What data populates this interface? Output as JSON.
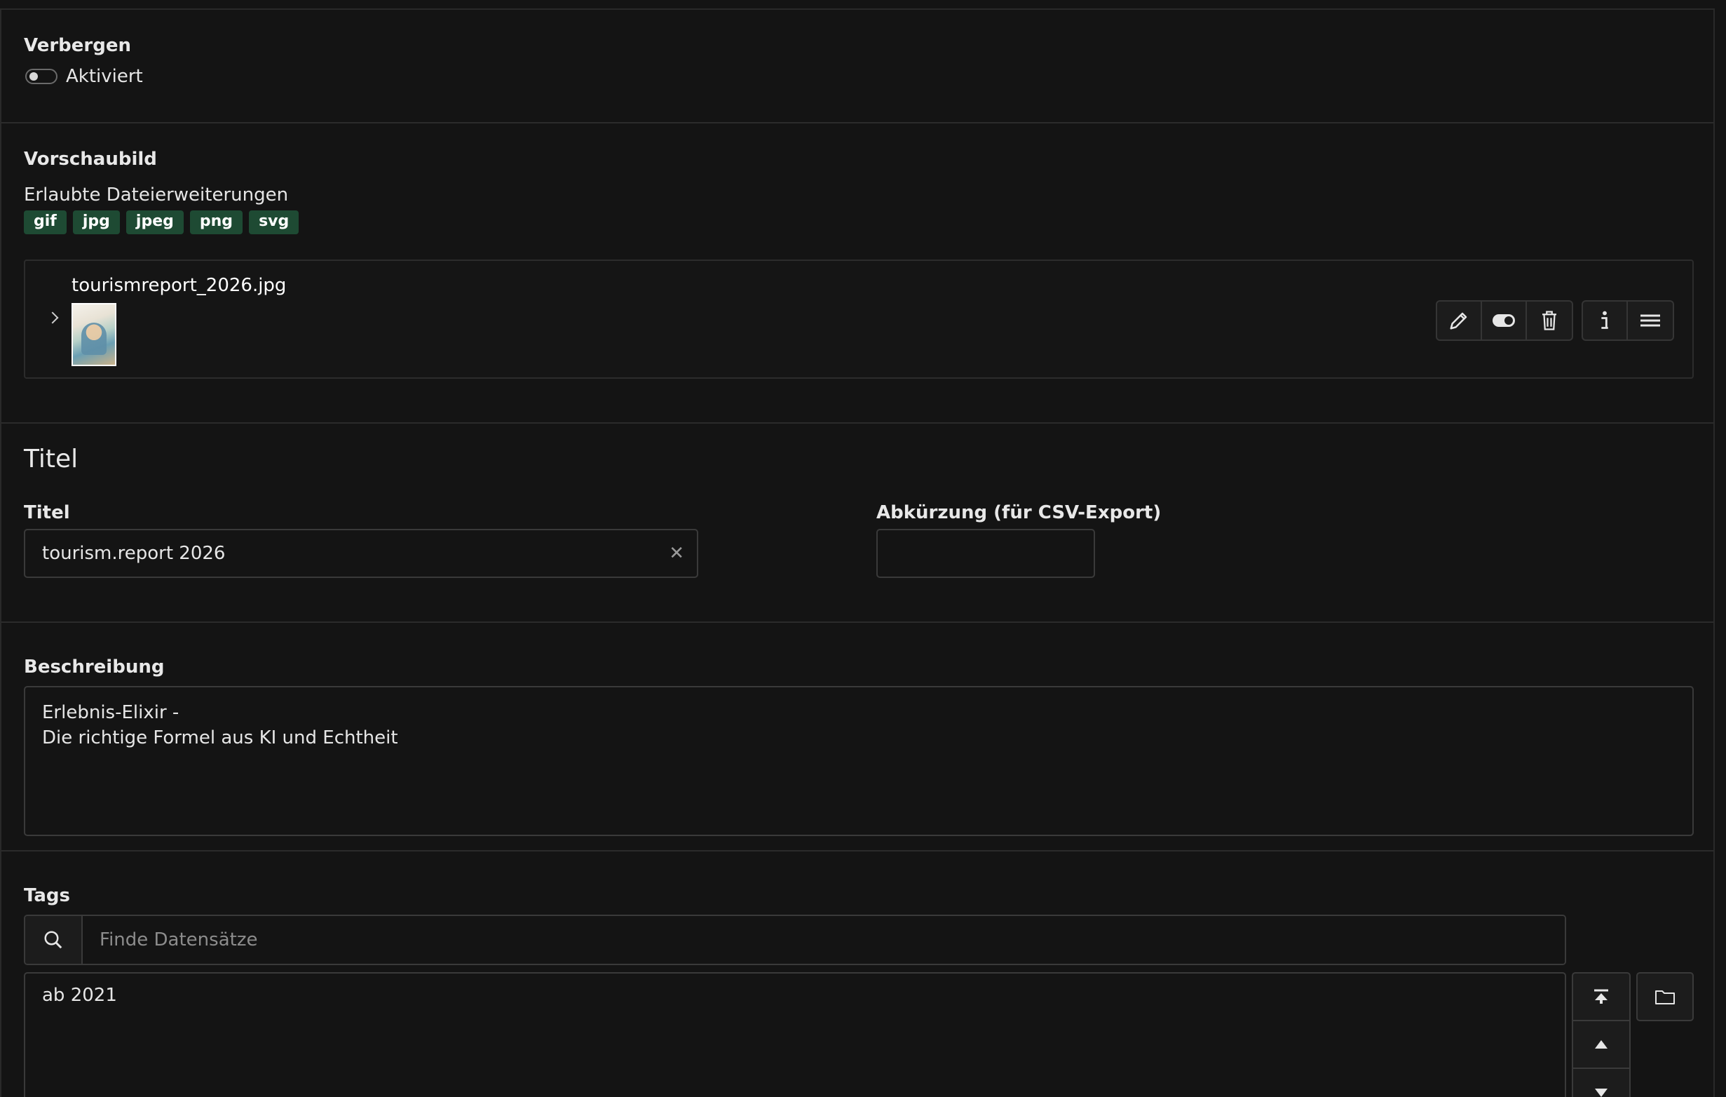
{
  "hide": {
    "label": "Verbergen",
    "toggle_label": "Aktiviert"
  },
  "preview": {
    "label": "Vorschaubild",
    "allowed_label": "Erlaubte Dateierweiterungen",
    "extensions": [
      "gif",
      "jpg",
      "jpeg",
      "png",
      "svg"
    ],
    "file": {
      "name": "tourismreport_2026.jpg",
      "actions": [
        "pencil-icon",
        "toggle-icon",
        "trash-icon",
        "info-icon",
        "menu-icon"
      ]
    }
  },
  "title_section": {
    "heading": "Titel",
    "title_label": "Titel",
    "title_value": "tourism.report 2026",
    "abbr_label": "Abkürzung (für CSV-Export)",
    "abbr_value": ""
  },
  "description": {
    "label": "Beschreibung",
    "value": "Erlebnis-Elixir -\nDie richtige Formel aus KI und Echtheit"
  },
  "tags": {
    "label": "Tags",
    "search_placeholder": "Finde Datensätze",
    "items": [
      "ab 2021"
    ]
  },
  "colors": {
    "background": "#141414",
    "badge": "#1e4a33",
    "border": "#3a3a3a"
  }
}
